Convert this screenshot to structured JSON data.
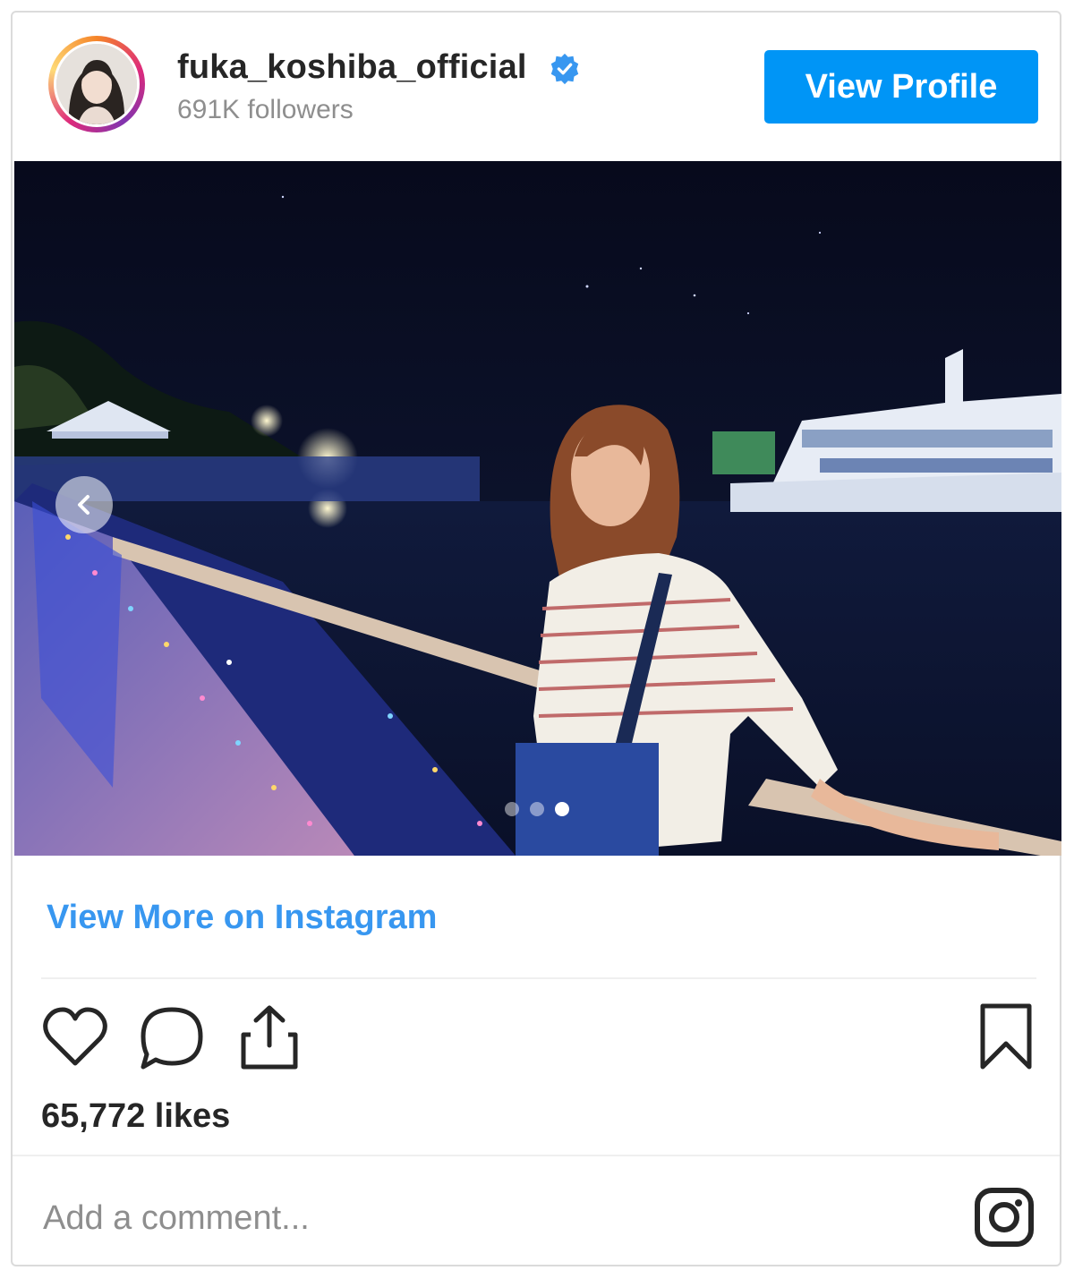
{
  "header": {
    "username": "fuka_koshiba_official",
    "followers": "691K followers",
    "view_profile_label": "View Profile"
  },
  "post": {
    "image_count": 3,
    "active_image_index": 3,
    "view_more_label": "View More on Instagram",
    "likes": "65,772 likes"
  },
  "comment": {
    "placeholder": "Add a comment..."
  },
  "icons": {
    "verified": "verified-badge-icon",
    "prev": "chevron-left-icon",
    "like": "heart-icon",
    "comment": "comment-icon",
    "share": "share-icon",
    "save": "bookmark-icon",
    "brand": "instagram-logo-icon"
  },
  "colors": {
    "accent": "#0095f6",
    "link": "#3897f0",
    "text": "#262626",
    "muted": "#8e8e8e",
    "border": "#dbdbdb"
  }
}
